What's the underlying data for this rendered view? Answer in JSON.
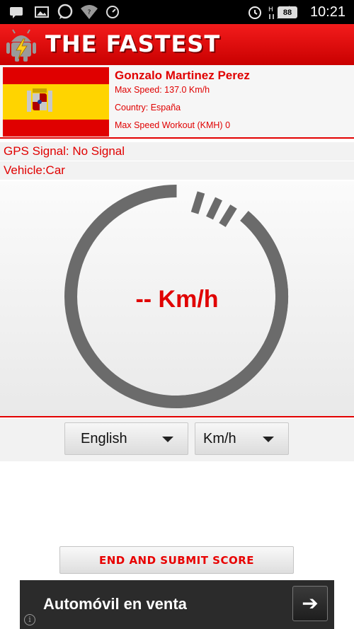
{
  "status_bar": {
    "time": "10:21",
    "battery": "88",
    "icons": [
      "message-icon",
      "image-icon",
      "whatsapp-icon",
      "wifi-icon",
      "speedometer-icon",
      "alarm-icon",
      "data-icon",
      "signal-icon",
      "battery-icon"
    ]
  },
  "app": {
    "title": "THE FASTEST",
    "accent": "#e00000"
  },
  "profile": {
    "name": "Gonzalo Martinez Perez",
    "max_speed": "Max Speed: 137.0 Km/h",
    "country": "Country: España",
    "max_speed_workout": "Max Speed Workout (KMH) 0",
    "flag": "spain-flag"
  },
  "gps": "GPS Signal: No Signal",
  "vehicle": "Vehicle:Car",
  "gauge": {
    "speed_text": "-- Km/h"
  },
  "language_select": {
    "value": "English"
  },
  "unit_select": {
    "value": "Km/h"
  },
  "submit_button": "END AND SUBMIT SCORE",
  "ad": {
    "title": "Automóvil en venta",
    "arrow": "➔",
    "info": "i"
  }
}
